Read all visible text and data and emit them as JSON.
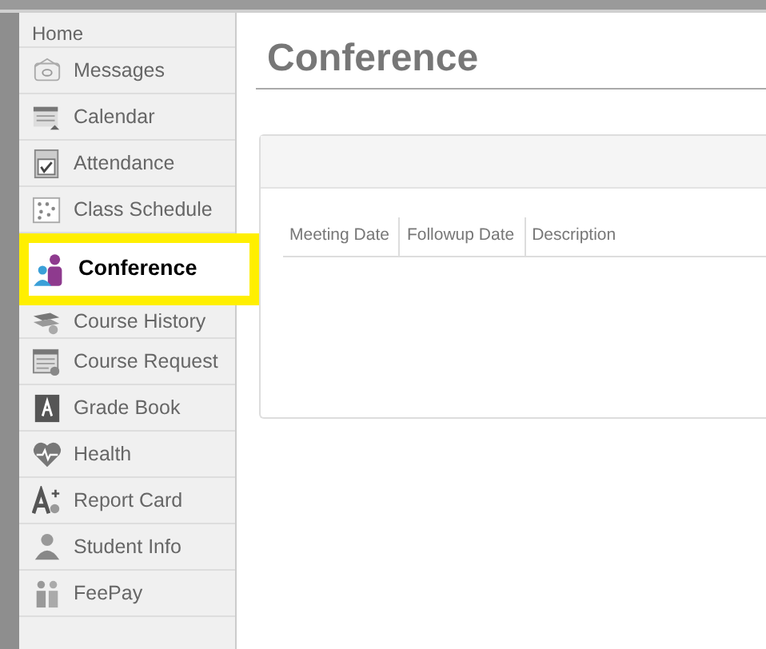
{
  "sidebar": {
    "header": "Home",
    "items": [
      {
        "label": "Messages",
        "selected": false
      },
      {
        "label": "Calendar",
        "selected": false
      },
      {
        "label": "Attendance",
        "selected": false
      },
      {
        "label": "Class Schedule",
        "selected": false
      },
      {
        "label": "Conference",
        "selected": true
      },
      {
        "label": "Course History",
        "selected": false
      },
      {
        "label": "Course Request",
        "selected": false
      },
      {
        "label": "Grade Book",
        "selected": false
      },
      {
        "label": "Health",
        "selected": false
      },
      {
        "label": "Report Card",
        "selected": false
      },
      {
        "label": "Student Info",
        "selected": false
      },
      {
        "label": "FeePay",
        "selected": false
      }
    ]
  },
  "page": {
    "title": "Conference"
  },
  "table": {
    "columns": [
      "Meeting Date",
      "Followup Date",
      "Description"
    ]
  }
}
